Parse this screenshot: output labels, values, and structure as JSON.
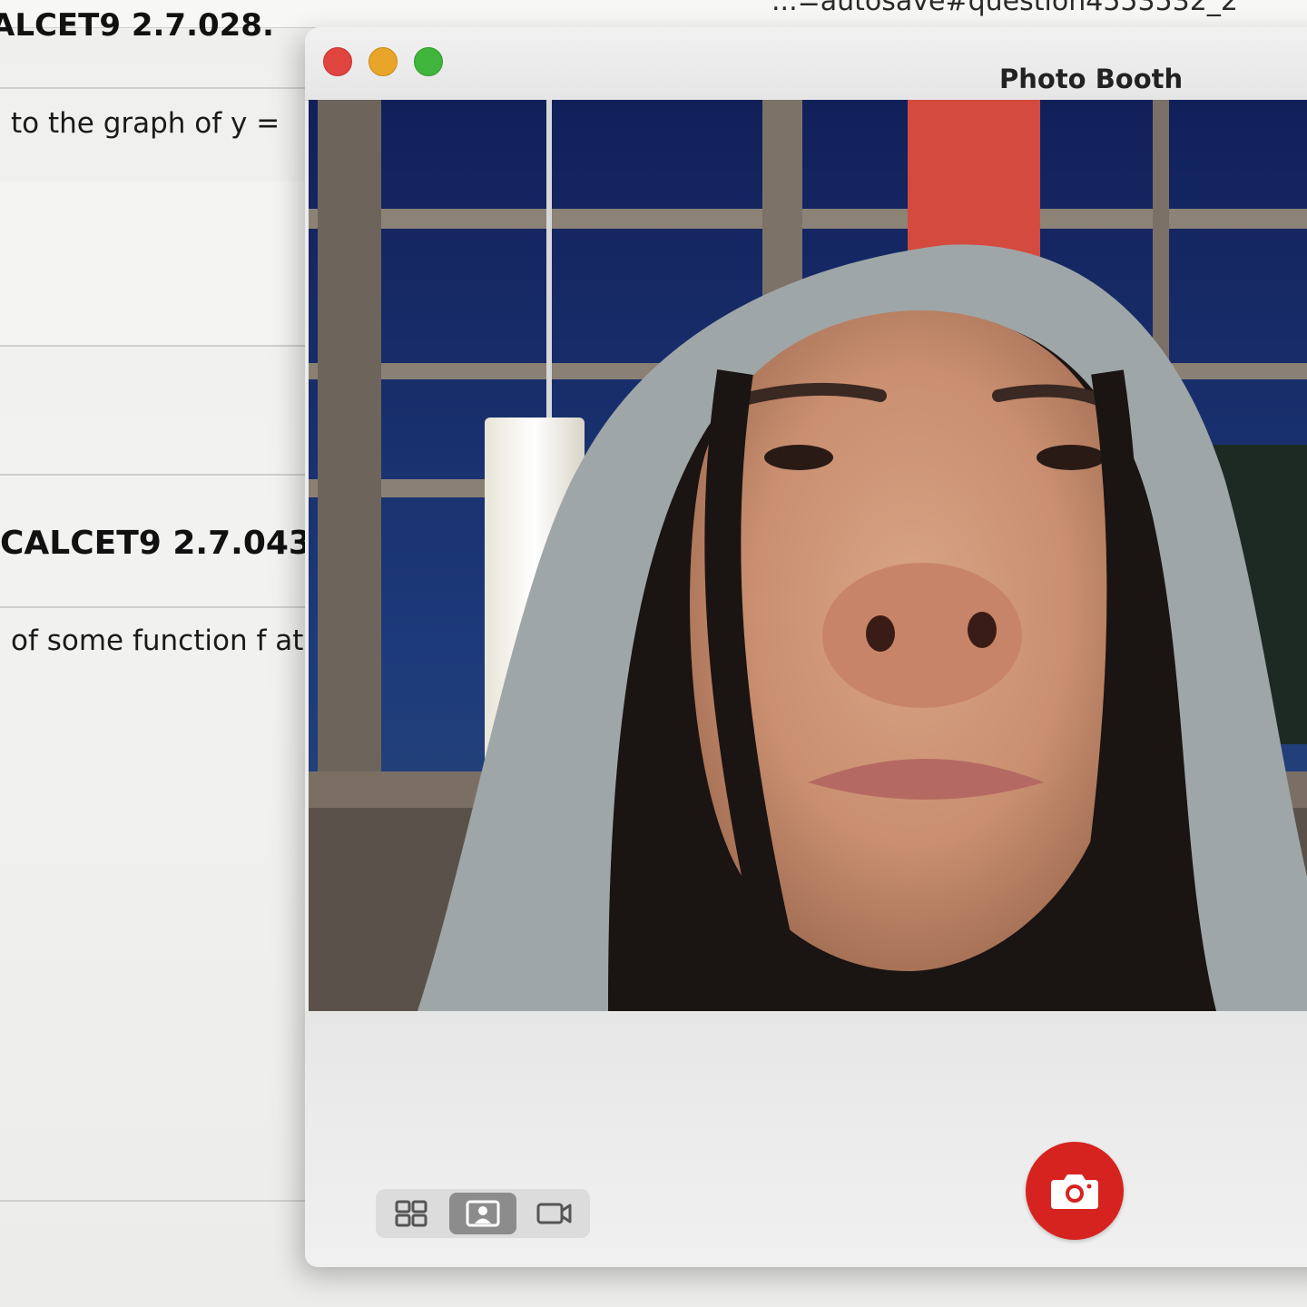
{
  "browser": {
    "url_fragment": "...=autosave#question4553532_2"
  },
  "webassign": {
    "question_1_header": "ALCET9 2.7.028.",
    "question_1_text": "to the graph of y =",
    "question_2_header": "CALCET9 2.7.043.",
    "question_2_text": "of some function f at"
  },
  "photo_booth": {
    "window_title": "Photo Booth",
    "traffic_lights": [
      {
        "name": "close",
        "color": "#e0443e"
      },
      {
        "name": "minimize",
        "color": "#e8a52a"
      },
      {
        "name": "zoom",
        "color": "#3fb53b"
      }
    ],
    "view_modes": [
      {
        "name": "four-up-grid",
        "active": false
      },
      {
        "name": "single-photo",
        "active": true
      },
      {
        "name": "video",
        "active": false
      }
    ],
    "shutter_color": "#d7231f"
  }
}
